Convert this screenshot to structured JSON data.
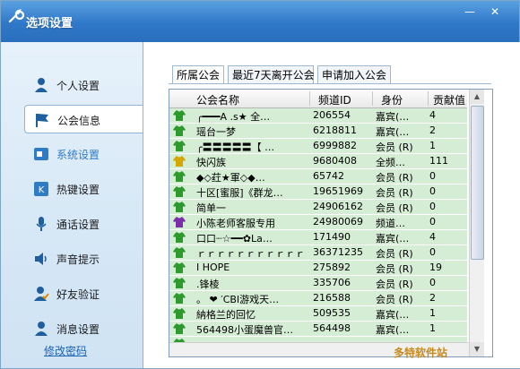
{
  "window": {
    "title": "选项设置",
    "minimize": "—",
    "close": "✕"
  },
  "sidebar": {
    "items": [
      {
        "label": "个人设置",
        "icon": "person-icon"
      },
      {
        "label": "公会信息",
        "icon": "flag-icon"
      },
      {
        "label": "系统设置",
        "icon": "system-icon"
      },
      {
        "label": "热键设置",
        "icon": "hotkey-icon"
      },
      {
        "label": "通话设置",
        "icon": "microphone-icon"
      },
      {
        "label": "声音提示",
        "icon": "speaker-icon"
      },
      {
        "label": "好友验证",
        "icon": "friend-verify-icon"
      },
      {
        "label": "消息设置",
        "icon": "message-icon"
      }
    ],
    "modify_password": "修改密码"
  },
  "tabs": [
    "所属公会",
    "最近7天离开公会",
    "申请加入公会"
  ],
  "table": {
    "headers": [
      "公会名称",
      "频道ID",
      "身份",
      "贡献值"
    ],
    "rows": [
      {
        "name": "╭━━━A .s★ 全…",
        "id": "206554",
        "role": "嘉宾(…",
        "contrib": "4",
        "icon_color": "#2e9a2e"
      },
      {
        "name": "瑶台一梦",
        "id": "6218811",
        "role": "嘉宾(…",
        "contrib": "2",
        "icon_color": "#2e9a2e"
      },
      {
        "name": "╭〓〓〓〓〓【 …",
        "id": "6999882",
        "role": "会员 (R)",
        "contrib": "1",
        "icon_color": "#2e9a2e"
      },
      {
        "name": "快闪族",
        "id": "9680408",
        "role": "全频…",
        "contrib": "111",
        "icon_color": "#d4a800"
      },
      {
        "name": "◆◇荭★軍◇◆…",
        "id": "65742",
        "role": "会员 (R)",
        "contrib": "0",
        "icon_color": "#2e9a2e"
      },
      {
        "name": "十区[蜜服]《群龙…",
        "id": "19651969",
        "role": "会员 (R)",
        "contrib": "0",
        "icon_color": "#2e9a2e"
      },
      {
        "name": "简单一",
        "id": "24906162",
        "role": "会员 (R)",
        "contrib": "0",
        "icon_color": "#2e9a2e"
      },
      {
        "name": "小陈老师客服专用",
        "id": "24980069",
        "role": "频道…",
        "contrib": "0",
        "icon_color": "#7a2ea8"
      },
      {
        "name": "口口┈☆━━✿La…",
        "id": "171490",
        "role": "嘉宾(…",
        "contrib": "4",
        "icon_color": "#2e9a2e"
      },
      {
        "name": "ｒｒｒｒｒｒｒｒｒｒｒｒ…",
        "id": "36371235",
        "role": "会员 (R)",
        "contrib": "0",
        "icon_color": "#2e9a2e"
      },
      {
        "name": "I HOPE",
        "id": "275892",
        "role": "会员 (R)",
        "contrib": "19",
        "icon_color": "#2e9a2e"
      },
      {
        "name": ".锋棱",
        "id": "335706",
        "role": "会员 (R)",
        "contrib": "0",
        "icon_color": "#2e9a2e"
      },
      {
        "name": "。 ❤ ′CBI游戏天…",
        "id": "216588",
        "role": "会员 (R)",
        "contrib": "2",
        "icon_color": "#2e9a2e"
      },
      {
        "name": "納格兰的回忆",
        "id": "509535",
        "role": "嘉宾(…",
        "contrib": "1",
        "icon_color": "#2e9a2e"
      },
      {
        "name": "564498小蛋魔兽官…",
        "id": "564498",
        "role": "嘉宾(…",
        "contrib": "1",
        "icon_color": "#2e9a2e"
      },
      {
        "name": "",
        "id": "",
        "role": "",
        "contrib": "",
        "icon_color": "#2e9a2e"
      }
    ]
  },
  "watermark": "多特软件站"
}
